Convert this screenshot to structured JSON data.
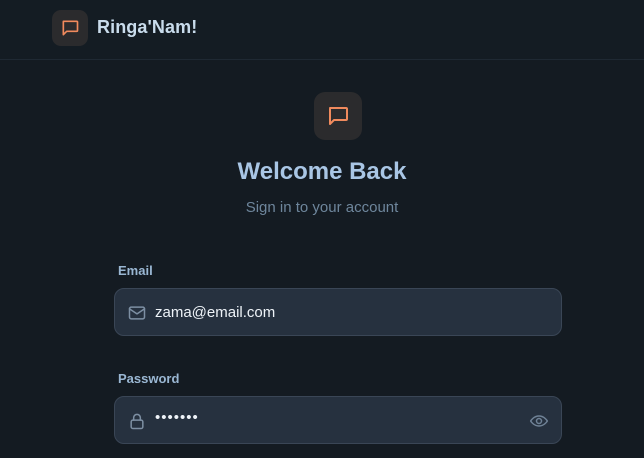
{
  "header": {
    "app_name": "Ringa'Nam!",
    "logo_icon": "chat-bubble-icon"
  },
  "hero": {
    "logo_icon": "chat-bubble-icon",
    "title": "Welcome Back",
    "subtitle": "Sign in to your account"
  },
  "form": {
    "email": {
      "label": "Email",
      "value": "zama@email.com",
      "icon": "mail-icon"
    },
    "password": {
      "label": "Password",
      "masked_value": "•••••••",
      "icon": "lock-icon",
      "toggle_icon": "eye-icon"
    }
  },
  "colors": {
    "background": "#141b22",
    "accent": "#f08a5d",
    "title": "#a9c6e5",
    "field_bg": "#26313f"
  }
}
